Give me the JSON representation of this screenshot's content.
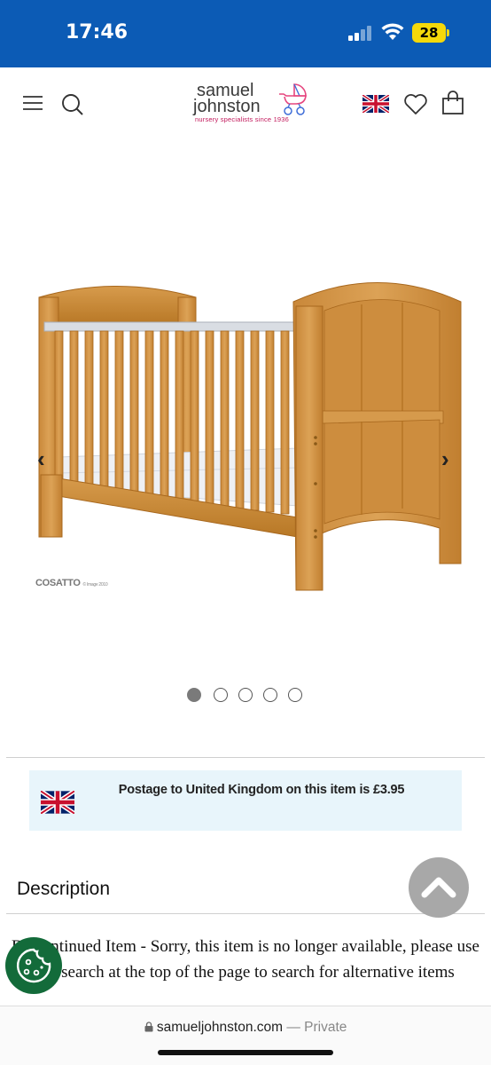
{
  "status_bar": {
    "time": "17:46",
    "battery": "28",
    "background": "#0c5bb5"
  },
  "header": {
    "logo": {
      "line1": "samuel",
      "line2": "johnston",
      "tagline": "nursery specialists since 1936"
    },
    "icons": [
      "menu-icon",
      "search-icon",
      "uk-flag-icon",
      "heart-icon",
      "shopping-bag-icon"
    ]
  },
  "gallery": {
    "watermark_brand": "COSATTO",
    "watermark_small": "© Image 2010",
    "dot_count": 5,
    "active_dot": 0,
    "prev_arrow": "‹",
    "next_arrow": "›"
  },
  "postage": {
    "text": "Postage to United Kingdom on this item is £3.95",
    "background": "#e8f5fb"
  },
  "description": {
    "title": "Description",
    "body": "Discontinued Item - Sorry, this item is no longer available, please use the search at the top of the page to search for alternative items"
  },
  "browser": {
    "url": "samueljohnston.com",
    "separator": "—",
    "mode": "Private"
  }
}
